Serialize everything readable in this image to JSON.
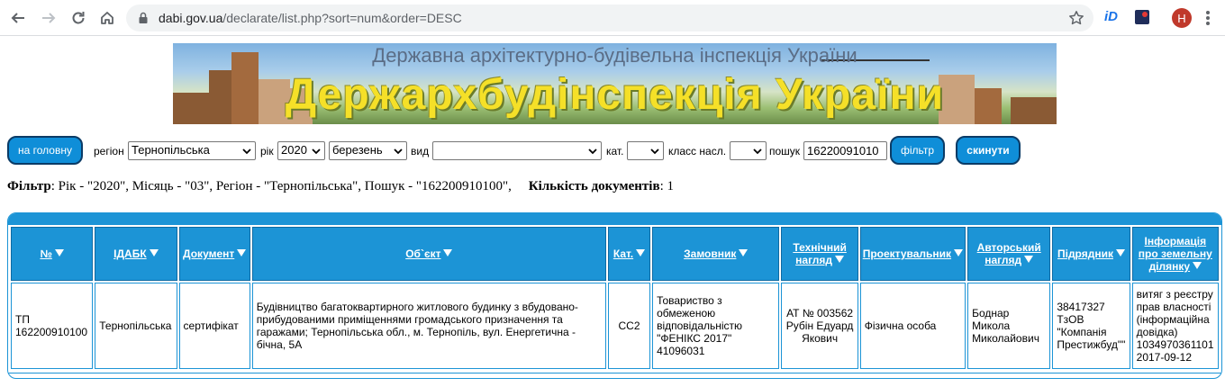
{
  "browser": {
    "url_host": "dabi.gov.ua",
    "url_path": "/declarate/list.php?sort=num&order=DESC",
    "extension_label": "iD",
    "profile_initial": "Н"
  },
  "banner": {
    "subtitle": "Державна архітектурно-будівельна інспекція України",
    "title": "Держархбудінспекція України"
  },
  "filters": {
    "home_button": "на головну",
    "region_label": "регіон",
    "region_value": "Тернопільська",
    "year_label": "рік",
    "year_value": "2020",
    "month_value": "березень",
    "kind_label": "вид",
    "kind_value": "",
    "cat_label": "кат.",
    "cat_value": "",
    "class_label": "класс насл.",
    "class_value": "",
    "search_label": "пошук",
    "search_value": "16220091010",
    "filter_button": "фільтр",
    "reset_button": "скинути"
  },
  "summary": {
    "filter_title": "Фільтр",
    "filter_text": ": Рік - \"2020\", Місяць - \"03\", Регіон - \"Тернопільська\", Пошук - \"162200910100\",",
    "count_title": "Кількість документів",
    "count_value": ": 1"
  },
  "table": {
    "headers": [
      "№",
      "ІДАБК",
      "Документ",
      "Об`єкт",
      "Кат.",
      "Замовник",
      "Технічний нагляд",
      "Проектувальник",
      "Авторський нагляд",
      "Підрядник",
      "Інформація про земельну ділянку"
    ],
    "rows": [
      {
        "num": "ТП 162200910100",
        "idabk": "Тернопільська",
        "doc": "сертифікат",
        "object": "Будівництво багатоквартирного житлового будинку з вбудовано-прибудованими приміщеннями громадського призначення та гаражами; Тернопільська обл., м. Тернопіль, вул. Енергетична - бічна, 5А",
        "cat": "СС2",
        "customer": "Товариство з обмеженою відповідальністю \"ФЕНІКС 2017\" 41096031",
        "tech": "АТ № 003562 Рубін Едуард Якович",
        "designer": "Фізична особа",
        "author": "Боднар Микола Миколайович",
        "contractor": "38417327 ТзОВ \"Компанія Престижбуд\"\"",
        "land": "витяг з реєстру прав власності (інформаційна довідка) 1034970361101 2017-09-12"
      }
    ]
  }
}
